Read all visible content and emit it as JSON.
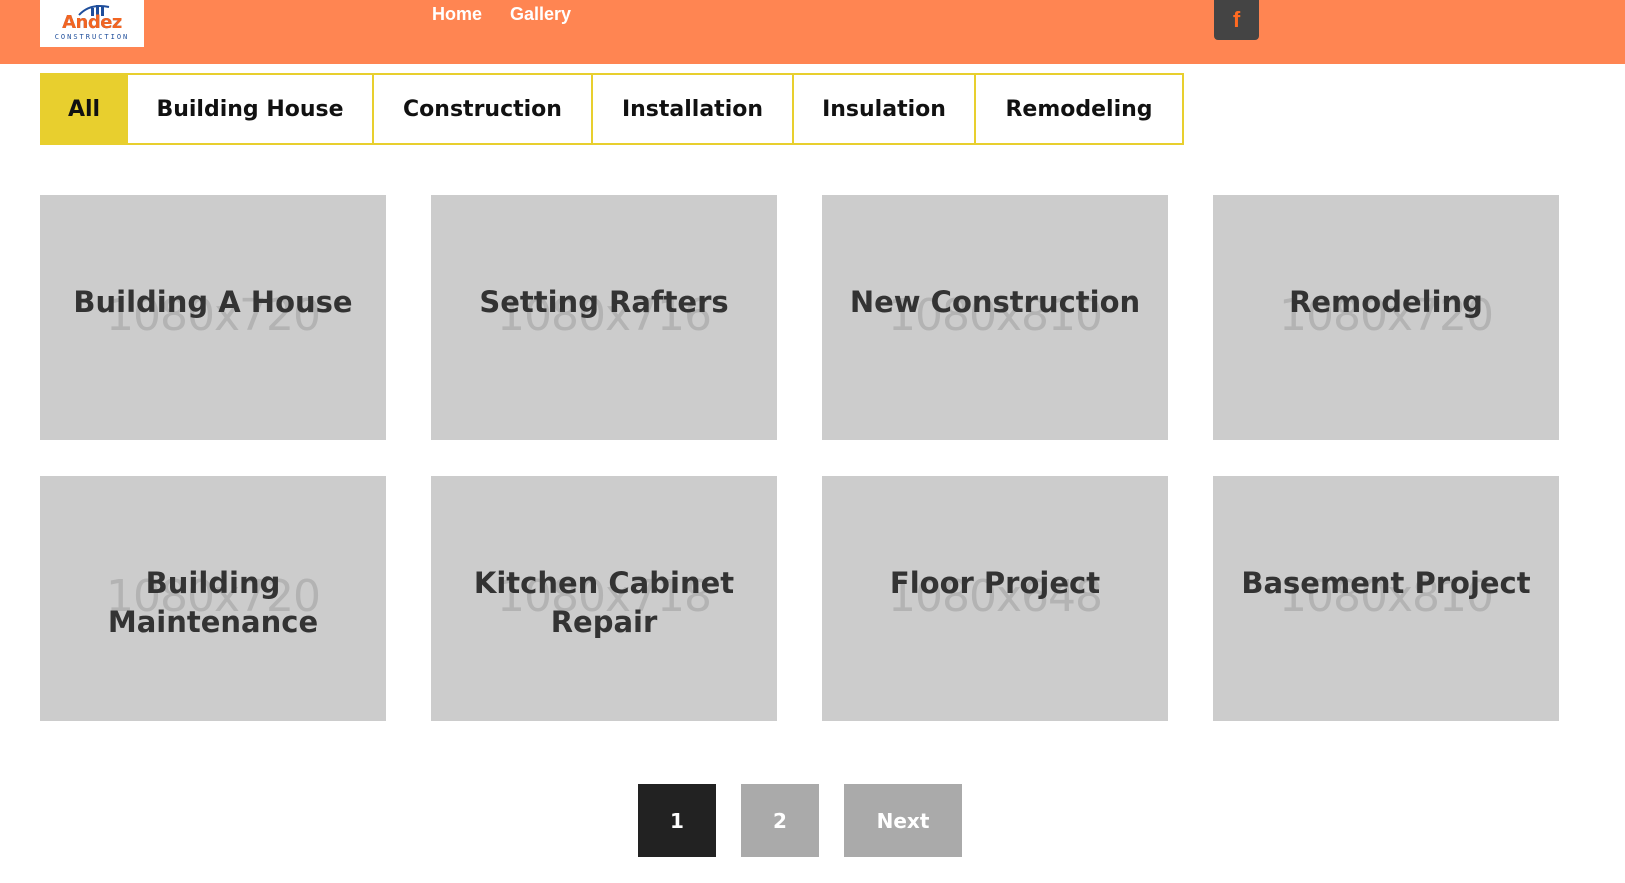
{
  "header": {
    "logo": {
      "name": "Andez",
      "subtitle": "CONSTRUCTION"
    },
    "nav": [
      {
        "label": "Home"
      },
      {
        "label": "Gallery"
      }
    ],
    "social": {
      "facebook_glyph": "f"
    },
    "colors": {
      "background": "#ff8552",
      "social_bg": "#444444",
      "social_icon": "#ff6a21"
    }
  },
  "filters": {
    "items": [
      {
        "label": "All",
        "active": true
      },
      {
        "label": "Building House",
        "active": false
      },
      {
        "label": "Construction",
        "active": false
      },
      {
        "label": "Installation",
        "active": false
      },
      {
        "label": "Insulation",
        "active": false
      },
      {
        "label": "Remodeling",
        "active": false
      }
    ],
    "accent": "#e8cf2e"
  },
  "gallery": {
    "items": [
      {
        "title": "Building A House",
        "placeholder": "1080x720"
      },
      {
        "title": "Setting Rafters",
        "placeholder": "1080x716"
      },
      {
        "title": "New Construction",
        "placeholder": "1080x810"
      },
      {
        "title": "Remodeling",
        "placeholder": "1080x720"
      },
      {
        "title": "Building Maintenance",
        "placeholder": "1080x720"
      },
      {
        "title": "Kitchen Cabinet Repair",
        "placeholder": "1080x718"
      },
      {
        "title": "Floor Project",
        "placeholder": "1080x648"
      },
      {
        "title": "Basement Project",
        "placeholder": "1080x810"
      }
    ]
  },
  "pagination": {
    "pages": [
      {
        "label": "1",
        "current": true
      },
      {
        "label": "2",
        "current": false
      }
    ],
    "next_label": "Next"
  }
}
